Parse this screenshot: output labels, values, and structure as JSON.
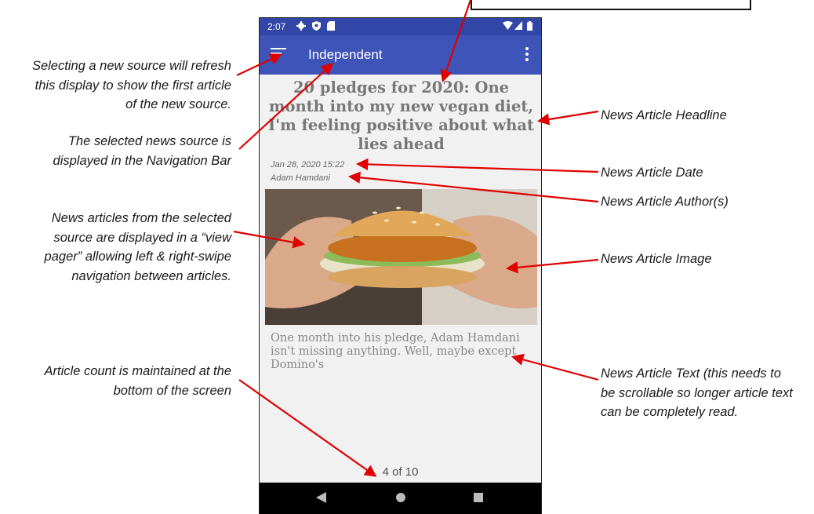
{
  "annotations": {
    "left": [
      "Selecting a new source will refresh this display to show the first article of the new source.",
      "The selected news source is displayed in the Navigation Bar",
      "News articles from the selected source are displayed in a “view pager” allowing left & right-swipe navigation between articles.",
      "Article count is maintained at the bottom of the screen"
    ],
    "right": [
      "News Article Headline",
      "News Article Date",
      "News Article Author(s)",
      "News Article Image",
      "News Article Text (this needs to be scrollable so longer article text can be completely read."
    ],
    "arrow_color": "#e00000"
  },
  "status_bar": {
    "time": "2:07",
    "icons": [
      "gear-icon",
      "shield-icon",
      "sd-card-icon",
      "wifi-icon",
      "signal-icon",
      "battery-icon"
    ],
    "color": "#3246a8"
  },
  "app_bar": {
    "title": "Independent",
    "menu_icon": "hamburger-menu-icon",
    "overflow_icon": "more-vert-icon",
    "color": "#3e54b8"
  },
  "article": {
    "headline": "20 pledges for 2020: One month into my new vegan diet, I'm feeling positive about what lies ahead",
    "date": "Jan 28, 2020 15:22",
    "author": "Adam Hamdani",
    "image": "vegan-burger-photo",
    "text": "One month into his pledge, Adam Hamdani isn't missing anything. Well, maybe except Domino's"
  },
  "pager": {
    "count": "4 of 10"
  },
  "nav_bar": {
    "buttons": [
      "back-triangle-icon",
      "home-circle-icon",
      "recents-square-icon"
    ]
  }
}
